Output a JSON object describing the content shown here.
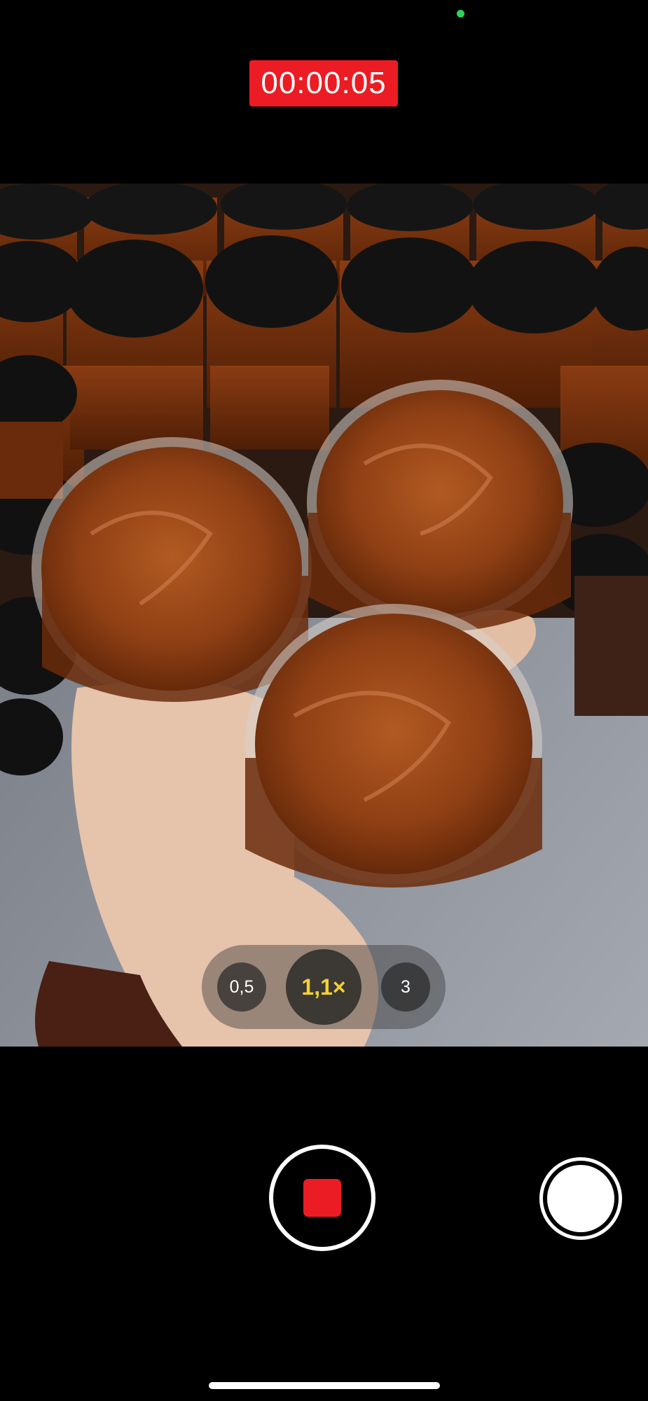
{
  "recording": {
    "timer": "00:00:05",
    "is_recording": true
  },
  "zoom": {
    "options": [
      {
        "label": "0,5",
        "active": false
      },
      {
        "label": "1,1×",
        "active": true
      },
      {
        "label": "3",
        "active": false
      }
    ]
  },
  "colors": {
    "record_red": "#eb1c24",
    "zoom_active": "#f2d230",
    "camera_active_dot": "#30d158"
  },
  "icons": {
    "record": "stop-square-icon",
    "snapshot": "shutter-icon"
  }
}
